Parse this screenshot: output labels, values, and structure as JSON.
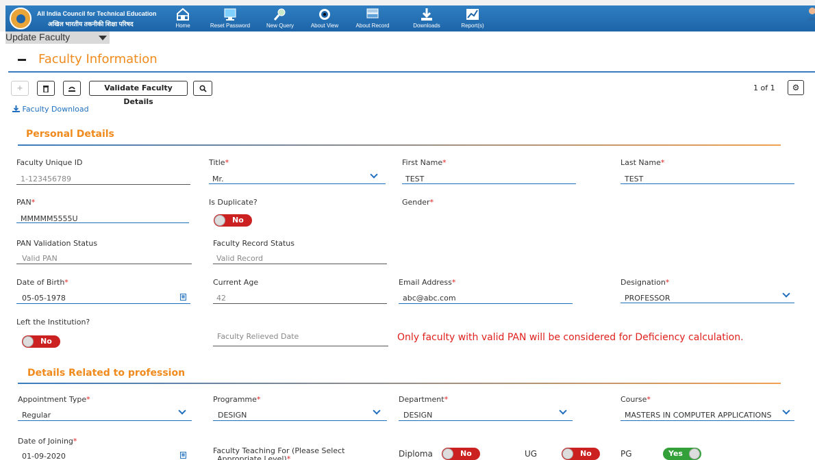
{
  "header": {
    "org_name_en": "All India Council for Technical Education",
    "org_name_hi": "अखिल भारतीय तकनीकी शिक्षा परिषद",
    "nav": [
      {
        "label": "Home",
        "icon": "home-icon"
      },
      {
        "label": "Reset Password",
        "icon": "reset-password-icon"
      },
      {
        "label": "New Query",
        "icon": "new-query-icon"
      },
      {
        "label": "About View",
        "icon": "eye-icon"
      },
      {
        "label": "About Record",
        "icon": "record-icon"
      },
      {
        "label": "Downloads",
        "icon": "download-icon"
      },
      {
        "label": "Report(s)",
        "icon": "report-chart-icon"
      }
    ]
  },
  "page": {
    "title": "Update Faculty",
    "section_title": "Faculty Information"
  },
  "toolbar": {
    "add": "+",
    "validate_label": "Validate Faculty Details",
    "pager": "1 of 1",
    "download_link": "Faculty Download"
  },
  "personal": {
    "heading": "Personal Details",
    "faculty_id_label": "Faculty Unique ID",
    "faculty_id_value": "1-123456789",
    "title_label": "Title",
    "title_value": "Mr.",
    "first_name_label": "First Name",
    "first_name_value": "TEST",
    "last_name_label": "Last Name",
    "last_name_value": "TEST",
    "pan_label": "PAN",
    "pan_value": "MMMMM5555U",
    "dup_label": "Is Duplicate?",
    "dup_value": "No",
    "gender_label": "Gender",
    "pan_status_label": "PAN Validation Status",
    "pan_status_value": "Valid PAN",
    "record_status_label": "Faculty Record Status",
    "record_status_value": "Valid Record",
    "dob_label": "Date of Birth",
    "dob_value": "05-05-1978",
    "age_label": "Current Age",
    "age_value": "42",
    "email_label": "Email Address",
    "email_value": "abc@abc.com",
    "designation_label": "Designation",
    "designation_value": "PROFESSOR",
    "left_label": "Left the Institution?",
    "left_value": "No",
    "relieved_placeholder": "Faculty Relieved Date",
    "warning": "Only faculty with valid PAN will be considered for Deficiency calculation."
  },
  "profession": {
    "heading": "Details Related to profession",
    "appointment_label": "Appointment Type",
    "appointment_value": "Regular",
    "programme_label": "Programme",
    "programme_value": "DESIGN",
    "department_label": "Department",
    "department_value": "DESIGN",
    "course_label": "Course",
    "course_value": "MASTERS IN COMPUTER APPLICATIONS",
    "doj_label": "Date of Joining",
    "doj_value": "01-09-2020",
    "teaching_label_1": "Faculty Teaching For (Please Select",
    "teaching_label_2": "Appropriate Level)",
    "diploma_label": "Diploma",
    "diploma_value": "No",
    "ug_label": "UG",
    "ug_value": "No",
    "pg_label": "PG",
    "pg_value": "Yes"
  },
  "colors": {
    "accent_orange": "#f08a1c",
    "brand_blue": "#1d64a8",
    "toggle_no": "#cc2121",
    "toggle_yes": "#34a03a",
    "required": "#e02020"
  }
}
